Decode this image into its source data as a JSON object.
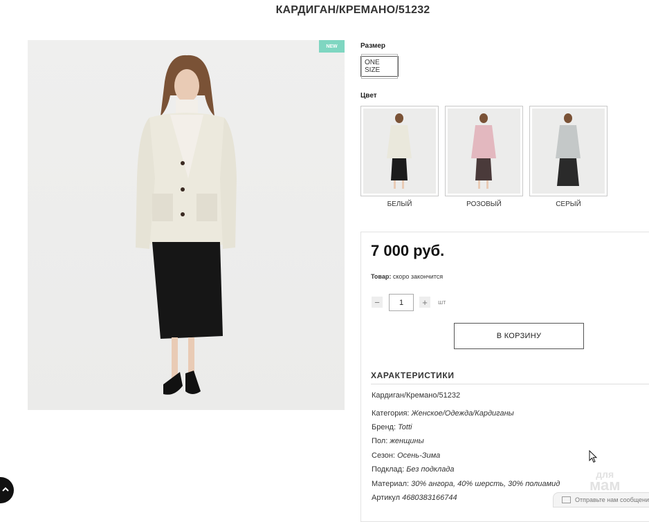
{
  "product": {
    "title": "КАРДИГАН/КРЕМАНО/51232",
    "badge": "NEW"
  },
  "options": {
    "size_label": "Размер",
    "size_value": "ONE SIZE",
    "color_label": "Цвет",
    "colors": [
      {
        "name": "БЕЛЫЙ",
        "cardigan": "#eae8dc",
        "bottom": "#1c1c1c"
      },
      {
        "name": "РОЗОВЫЙ",
        "cardigan": "#e3b8bf",
        "bottom": "#4a3a3a"
      },
      {
        "name": "СЕРЫЙ",
        "cardigan": "#c4c8c8",
        "bottom": "#2a2a2a"
      }
    ]
  },
  "purchase": {
    "price": "7 000 руб.",
    "stock_label": "Товар:",
    "stock_value": "скоро закончится",
    "quantity": "1",
    "minus": "−",
    "plus": "+",
    "unit": "шт",
    "cart_button": "В КОРЗИНУ"
  },
  "specs": {
    "heading": "ХАРАКТЕРИСТИКИ",
    "name": "Кардиган/Кремано/51232",
    "rows": [
      {
        "label": "Категория:",
        "value": "Женское/Одежда/Кардиганы"
      },
      {
        "label": "Бренд:",
        "value": "Totti"
      },
      {
        "label": "Пол:",
        "value": "женщины"
      },
      {
        "label": "Сезон:",
        "value": "Осень-Зима"
      },
      {
        "label": "Подклад:",
        "value": "Без подклада"
      },
      {
        "label": "Материал:",
        "value": "30% ангора, 40% шерсть, 30% полиамид"
      },
      {
        "label": "Артикул",
        "value": "4680383166744"
      }
    ]
  },
  "overlay": {
    "watermark_top": "для",
    "watermark_bottom": "мам",
    "chat": "Отправьте нам сообщение"
  }
}
